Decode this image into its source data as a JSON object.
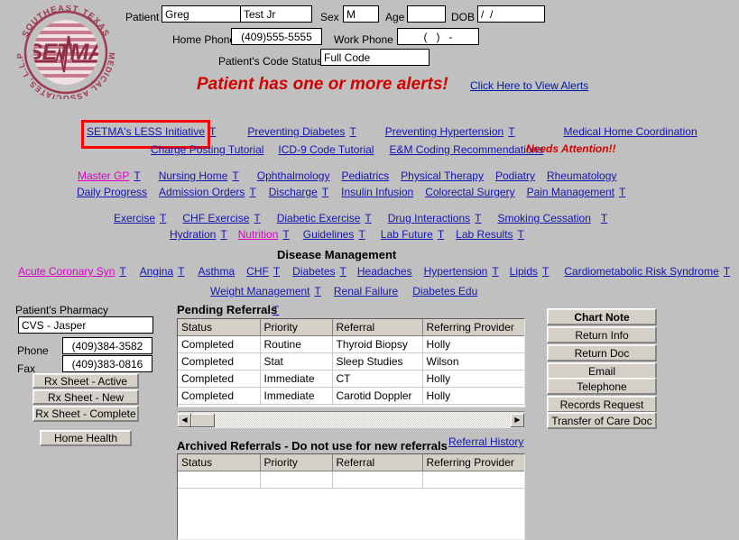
{
  "logo": {
    "top_arc": "SOUTHEAST TEXAS",
    "bottom_arc": "MEDICAL ASSOCIATES, L.L.P",
    "wordmark": "SETMA",
    "color": "#9e3b52"
  },
  "patient_form": {
    "patient_label": "Patient",
    "first_name": "Greg",
    "last_name": "Test Jr",
    "sex_label": "Sex",
    "sex": "M",
    "age_label": "Age",
    "age": "",
    "dob_label": "DOB",
    "dob": "/  /",
    "home_phone_label": "Home Phone",
    "home_phone": "(409)555-5555",
    "work_phone_label": "Work Phone",
    "work_phone": "(   )   -",
    "code_status_label": "Patient's Code Status",
    "code_status": "Full Code"
  },
  "alert": {
    "message": "Patient has one or more alerts!",
    "link": "Click Here to View Alerts",
    "color": "#d40000"
  },
  "nav": {
    "row1": [
      {
        "label": "SETMA's LESS Initiative",
        "tutorial": "T",
        "visited": false,
        "highlighted": true
      },
      {
        "label": "Preventing Diabetes",
        "tutorial": "T",
        "visited": false
      },
      {
        "label": "Preventing Hypertension",
        "tutorial": "T",
        "visited": false
      },
      {
        "label": "Medical Home Coordination",
        "tutorial": "",
        "visited": false
      }
    ],
    "row2": [
      {
        "label": "Charge Posting Tutorial",
        "tutorial": "",
        "visited": false
      },
      {
        "label": "ICD-9 Code Tutorial",
        "tutorial": "",
        "visited": false
      },
      {
        "label": "E&M Coding Recommendations",
        "tutorial": "",
        "visited": false
      }
    ],
    "needs_attention": "Needs Attention!!",
    "row3": [
      {
        "label": "Master GP",
        "tutorial": "T",
        "visited": true
      },
      {
        "label": "Nursing Home",
        "tutorial": "T",
        "visited": false
      },
      {
        "label": "Ophthalmology",
        "tutorial": "",
        "visited": false
      },
      {
        "label": "Pediatrics",
        "tutorial": "",
        "visited": false
      },
      {
        "label": "Physical Therapy",
        "tutorial": "",
        "visited": false
      },
      {
        "label": "Podiatry",
        "tutorial": "",
        "visited": false
      },
      {
        "label": "Rheumatology",
        "tutorial": "",
        "visited": false
      }
    ],
    "row4": [
      {
        "label": "Daily Progress",
        "tutorial": "",
        "visited": false
      },
      {
        "label": "Admission Orders",
        "tutorial": "T",
        "visited": false
      },
      {
        "label": "Discharge",
        "tutorial": "T",
        "visited": false
      },
      {
        "label": "Insulin Infusion",
        "tutorial": "",
        "visited": false
      },
      {
        "label": "Colorectal Surgery",
        "tutorial": "",
        "visited": false
      },
      {
        "label": "Pain Management",
        "tutorial": "T",
        "visited": false
      }
    ],
    "row5": [
      {
        "label": "Exercise",
        "tutorial": "T",
        "visited": false
      },
      {
        "label": "CHF Exercise",
        "tutorial": "T",
        "visited": false
      },
      {
        "label": "Diabetic Exercise",
        "tutorial": "T",
        "visited": false
      },
      {
        "label": "Drug Interactions",
        "tutorial": "T",
        "visited": false
      },
      {
        "label": "Smoking Cessation",
        "tutorial": "T",
        "visited": false
      }
    ],
    "row6": [
      {
        "label": "Hydration",
        "tutorial": "T",
        "visited": false
      },
      {
        "label": "Nutrition",
        "tutorial": "T",
        "visited": true
      },
      {
        "label": "Guidelines",
        "tutorial": "T",
        "visited": false
      },
      {
        "label": "Lab Future",
        "tutorial": "T",
        "visited": false
      },
      {
        "label": "Lab Results",
        "tutorial": "T",
        "visited": false
      }
    ]
  },
  "disease_management": {
    "title": "Disease Management",
    "row1": [
      {
        "label": "Acute Coronary Syn",
        "tutorial": "T",
        "visited": true
      },
      {
        "label": "Angina",
        "tutorial": "T",
        "visited": false
      },
      {
        "label": "Asthma",
        "tutorial": "",
        "visited": false
      },
      {
        "label": "CHF",
        "tutorial": "T",
        "visited": false
      },
      {
        "label": "Diabetes",
        "tutorial": "T",
        "visited": false
      },
      {
        "label": "Headaches",
        "tutorial": "",
        "visited": false
      },
      {
        "label": "Hypertension",
        "tutorial": "T",
        "visited": false
      },
      {
        "label": "Lipids",
        "tutorial": "T",
        "visited": false
      },
      {
        "label": "Cardiometabolic Risk Syndrome",
        "tutorial": "T",
        "visited": false
      }
    ],
    "row2": [
      {
        "label": "Weight Management",
        "tutorial": "T",
        "visited": false
      },
      {
        "label": "Renal Failure",
        "tutorial": "",
        "visited": false
      },
      {
        "label": "Diabetes Edu",
        "tutorial": "",
        "visited": false
      }
    ]
  },
  "pharmacy": {
    "title": "Patient's Pharmacy",
    "name": "CVS - Jasper",
    "phone_label": "Phone",
    "phone": "(409)384-3582",
    "fax_label": "Fax",
    "fax": "(409)383-0816",
    "buttons": [
      "Rx Sheet - Active",
      "Rx Sheet - New",
      "Rx Sheet - Complete"
    ],
    "home_health_button": "Home Health"
  },
  "pending_referrals": {
    "title": "Pending Referrals",
    "tutorial": "T",
    "columns": [
      "Status",
      "Priority",
      "Referral",
      "Referring Provider"
    ],
    "rows": [
      [
        "Completed",
        "Routine",
        "Thyroid Biopsy",
        "Holly"
      ],
      [
        "Completed",
        "Stat",
        "Sleep Studies",
        "Wilson"
      ],
      [
        "Completed",
        "Immediate",
        "CT",
        "Holly"
      ],
      [
        "Completed",
        "Immediate",
        "Carotid Doppler",
        "Holly"
      ]
    ],
    "scroll_left": "◀",
    "scroll_right": "▶"
  },
  "archived_referrals": {
    "title": "Archived Referrals - Do not use for new referrals",
    "history_link": "Referral History",
    "columns": [
      "Status",
      "Priority",
      "Referral",
      "Referring Provider"
    ],
    "rows": [
      [
        "",
        "",
        "",
        ""
      ]
    ]
  },
  "actions": {
    "buttons": [
      {
        "label": "Chart Note",
        "bold": true
      },
      {
        "label": "Return Info",
        "bold": false
      },
      {
        "label": "Return Doc",
        "bold": false
      },
      {
        "label": "Email",
        "bold": false
      },
      {
        "label": "Telephone",
        "bold": false
      },
      {
        "label": "Records Request",
        "bold": false
      },
      {
        "label": "Transfer of Care Doc",
        "bold": false
      }
    ]
  }
}
